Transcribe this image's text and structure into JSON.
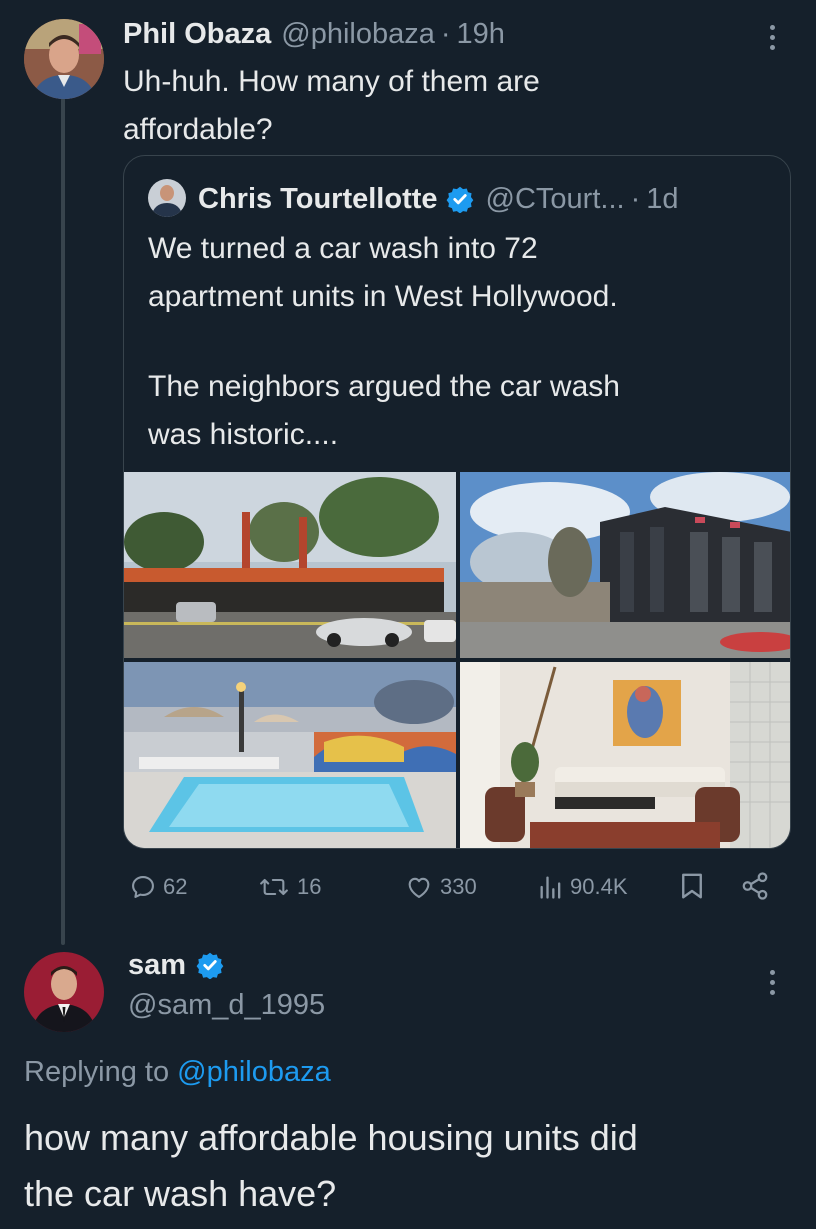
{
  "post1": {
    "display_name": "Phil Obaza",
    "handle": "@philobaza",
    "separator": "·",
    "time": "19h",
    "text_line1": "Uh-huh. How many of them are",
    "text_line2": "affordable?"
  },
  "quote": {
    "display_name": "Chris Tourtellotte",
    "handle": "@CTourt...",
    "separator": "·",
    "time": "1d",
    "line1": "We turned a car wash into 72",
    "line2": "apartment units in West Hollywood.",
    "line3": "The neighbors argued the car wash",
    "line4": "was historic...."
  },
  "actions": {
    "replies": "62",
    "reposts": "16",
    "likes": "330",
    "views": "90.4K"
  },
  "post2": {
    "display_name": "sam",
    "handle": "@sam_d_1995",
    "replying_prefix": "Replying to",
    "replying_to": "@philobaza",
    "text_line1": "how many affordable housing units did",
    "text_line2": "the car wash have?"
  },
  "colors": {
    "background": "#15202b",
    "accent": "#1d9bf0",
    "muted": "#8b98a5",
    "border": "#38444d"
  }
}
